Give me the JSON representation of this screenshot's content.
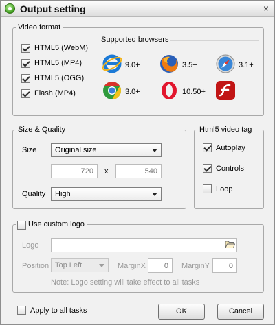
{
  "window": {
    "title": "Output setting",
    "close_label": "×"
  },
  "video_format": {
    "legend": "Video format",
    "options": [
      {
        "label": "HTML5 (WebM)",
        "checked": true
      },
      {
        "label": "HTML5 (MP4)",
        "checked": true
      },
      {
        "label": "HTML5 (OGG)",
        "checked": true
      },
      {
        "label": "Flash (MP4)",
        "checked": true
      }
    ],
    "browsers_title": "Supported browsers",
    "browsers": [
      {
        "icon": "internet-explorer-icon",
        "version": "9.0+"
      },
      {
        "icon": "firefox-icon",
        "version": "3.5+"
      },
      {
        "icon": "safari-icon",
        "version": "3.1+"
      },
      {
        "icon": "chrome-icon",
        "version": "3.0+"
      },
      {
        "icon": "opera-icon",
        "version": "10.50+"
      },
      {
        "icon": "flash-icon",
        "version": ""
      }
    ]
  },
  "size_quality": {
    "legend": "Size & Quality",
    "size_label": "Size",
    "size_value": "Original size",
    "width": "720",
    "x_label": "x",
    "height": "540",
    "quality_label": "Quality",
    "quality_value": "High"
  },
  "video_tag": {
    "legend": "Html5 video tag",
    "options": [
      {
        "label": "Autoplay",
        "checked": true
      },
      {
        "label": "Controls",
        "checked": true
      },
      {
        "label": "Loop",
        "checked": false
      }
    ]
  },
  "logo": {
    "legend": "Use custom logo",
    "checked": false,
    "logo_label": "Logo",
    "path": "",
    "position_label": "Position",
    "position_value": "Top Left",
    "marginx_label": "MarginX",
    "marginx": "0",
    "marginy_label": "MarginY",
    "marginy": "0",
    "note": "Note: Logo setting will take effect to all tasks"
  },
  "footer": {
    "apply_all_label": "Apply to all tasks",
    "apply_all_checked": false,
    "ok_label": "OK",
    "cancel_label": "Cancel"
  },
  "colors": {
    "accent": "#3d9b1c",
    "frame": "#f1f1f1",
    "group_border": "#a9a9a9"
  }
}
